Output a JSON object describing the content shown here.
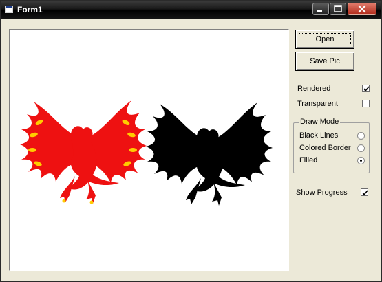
{
  "window": {
    "title": "Form1",
    "icons": {
      "app": "app-icon",
      "minimize": "minimize-icon",
      "maximize": "maximize-icon",
      "close": "close-icon"
    }
  },
  "buttons": {
    "open": "Open",
    "save_pic": "Save Pic"
  },
  "options": {
    "rendered": {
      "label": "Rendered",
      "checked": true
    },
    "transparent": {
      "label": "Transparent",
      "checked": false
    },
    "show_progress": {
      "label": "Show Progress",
      "checked": true
    }
  },
  "draw_mode": {
    "title": "Draw Mode",
    "items": [
      {
        "label": "Black Lines",
        "selected": false
      },
      {
        "label": "Colored Border",
        "selected": false
      },
      {
        "label": "Filled",
        "selected": true
      }
    ]
  },
  "picture": {
    "left_image_color": "#ee1111",
    "left_accent_color": "#ffcc00",
    "right_image_color": "#000000"
  }
}
